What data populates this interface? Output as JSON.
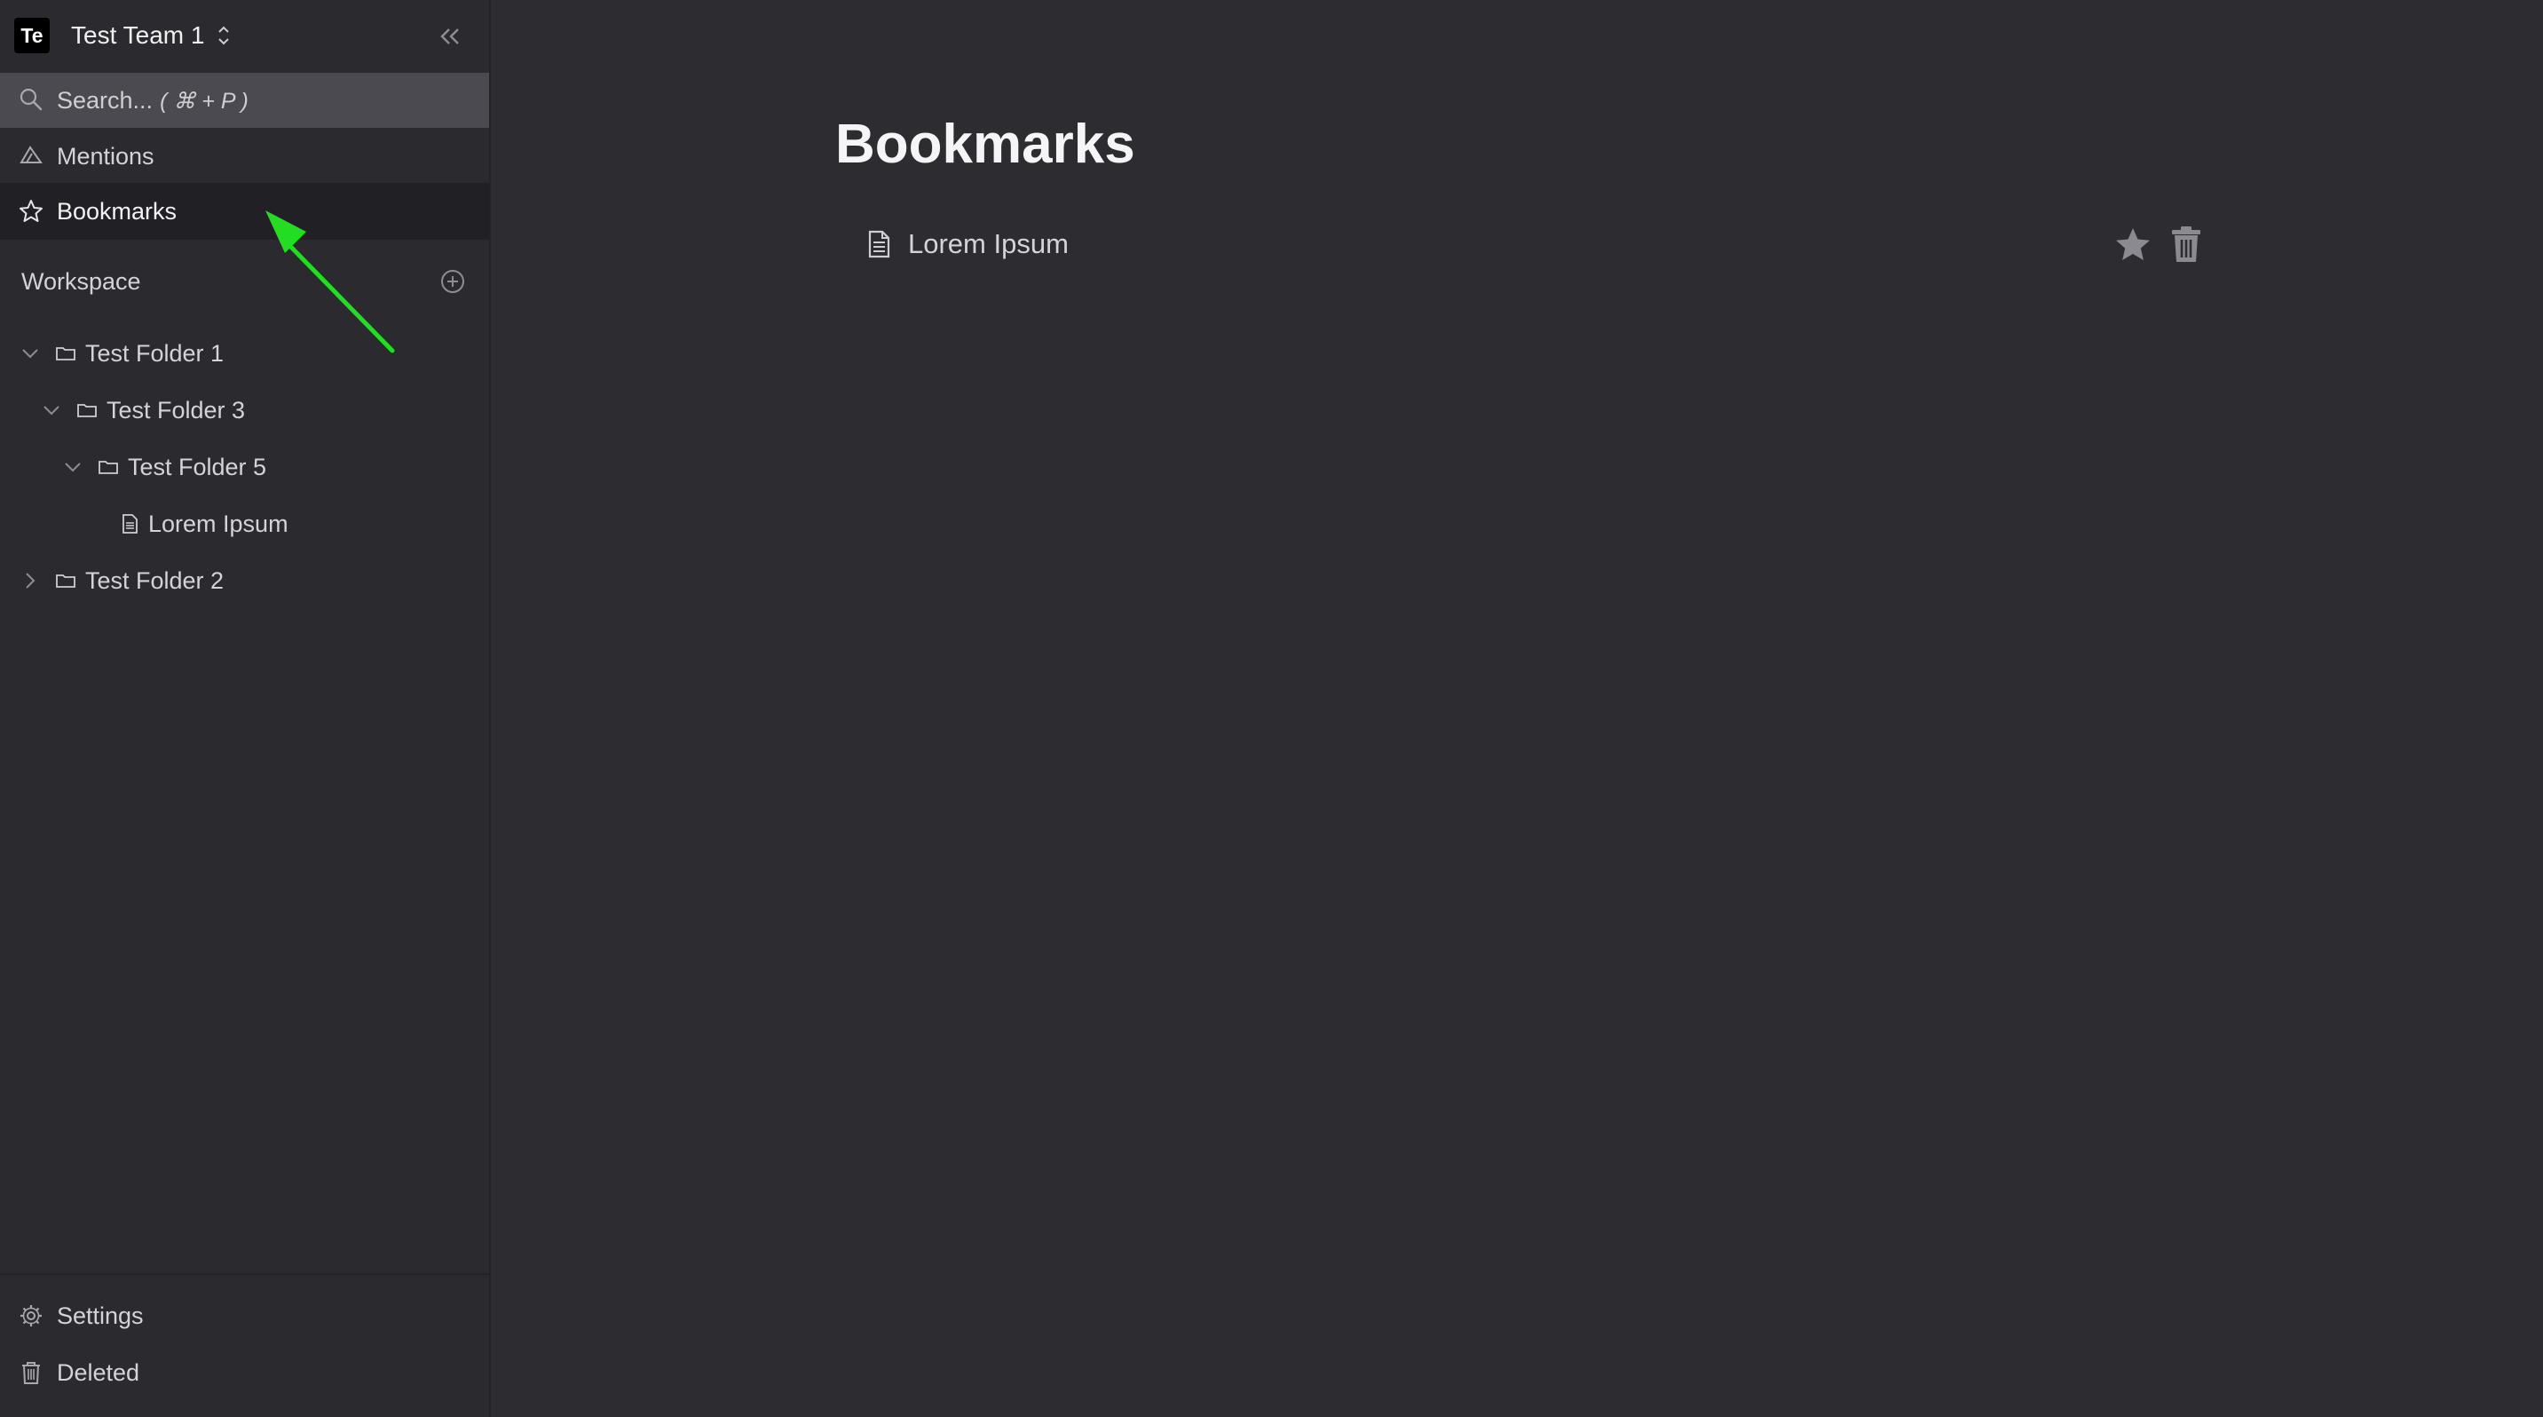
{
  "team": {
    "badge": "Te",
    "name": "Test Team 1"
  },
  "search": {
    "label": "Search...",
    "hint": "( ⌘ + P )"
  },
  "nav": {
    "mentions": "Mentions",
    "bookmarks": "Bookmarks"
  },
  "workspace": {
    "title": "Workspace",
    "tree": [
      {
        "label": "Test Folder 1",
        "type": "folder",
        "expanded": true
      },
      {
        "label": "Test Folder 3",
        "type": "folder",
        "expanded": true
      },
      {
        "label": "Test Folder 5",
        "type": "folder",
        "expanded": true
      },
      {
        "label": "Lorem Ipsum",
        "type": "document"
      },
      {
        "label": "Test Folder 2",
        "type": "folder",
        "expanded": false
      }
    ]
  },
  "footer": {
    "settings": "Settings",
    "deleted": "Deleted"
  },
  "main": {
    "title": "Bookmarks",
    "bookmarks": [
      {
        "label": "Lorem Ipsum"
      }
    ]
  },
  "colors": {
    "background": "#2c2c31",
    "sidebar": "#2a2a2f",
    "active_item": "#212125",
    "search_bar": "#4a4a50",
    "annotation_arrow": "#22dd22"
  },
  "icons": {
    "search": "search-icon",
    "mentions": "mentions-icon",
    "bookmarks": "star-icon",
    "add": "plus-circle-icon",
    "folder": "folder-icon",
    "document": "document-icon",
    "settings": "gear-icon",
    "deleted": "trash-icon"
  }
}
